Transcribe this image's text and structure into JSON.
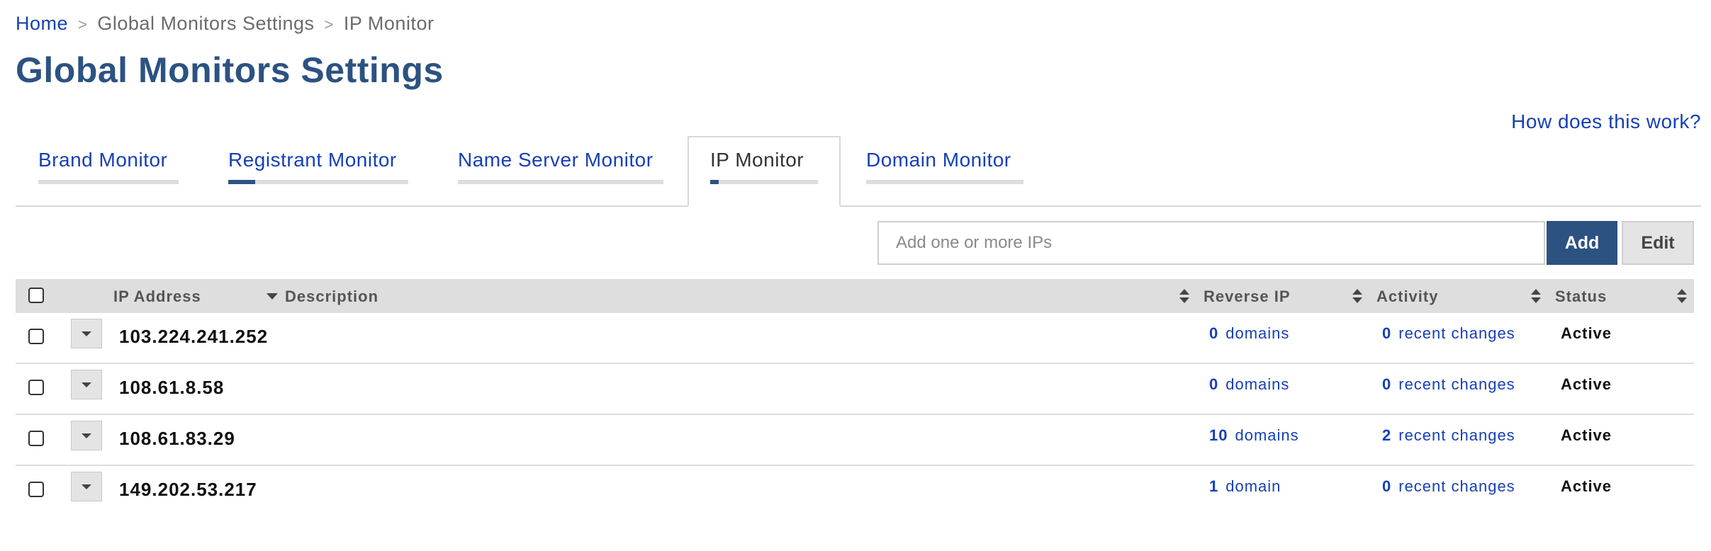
{
  "breadcrumb": {
    "home": "Home",
    "separator": ">",
    "parent": "Global Monitors Settings",
    "current": "IP Monitor"
  },
  "page_title": "Global Monitors Settings",
  "help_link": "How does this work?",
  "tabs": [
    {
      "label": "Brand Monitor",
      "progress": 0,
      "active": false
    },
    {
      "label": "Registrant Monitor",
      "progress": 0.15,
      "active": false
    },
    {
      "label": "Name Server Monitor",
      "progress": 0,
      "active": false
    },
    {
      "label": "IP Monitor",
      "progress": 0.08,
      "active": true
    },
    {
      "label": "Domain Monitor",
      "progress": 0,
      "active": false
    }
  ],
  "ip_input": {
    "placeholder": "Add one or more IPs",
    "value": ""
  },
  "buttons": {
    "add": "Add",
    "edit": "Edit"
  },
  "table": {
    "headers": {
      "ip_address": "IP Address",
      "description": "Description",
      "reverse_ip": "Reverse IP",
      "activity": "Activity",
      "status": "Status"
    },
    "rows": [
      {
        "ip": "103.224.241.252",
        "description": "",
        "reverse_count": "0",
        "reverse_unit": "domains",
        "activity_count": "0",
        "activity_unit": "recent changes",
        "status": "Active"
      },
      {
        "ip": "108.61.8.58",
        "description": "",
        "reverse_count": "0",
        "reverse_unit": "domains",
        "activity_count": "0",
        "activity_unit": "recent changes",
        "status": "Active"
      },
      {
        "ip": "108.61.83.29",
        "description": "",
        "reverse_count": "10",
        "reverse_unit": "domains",
        "activity_count": "2",
        "activity_unit": "recent changes",
        "status": "Active"
      },
      {
        "ip": "149.202.53.217",
        "description": "",
        "reverse_count": "1",
        "reverse_unit": "domain",
        "activity_count": "0",
        "activity_unit": "recent changes",
        "status": "Active"
      }
    ]
  },
  "colors": {
    "link": "#1740b5",
    "primary": "#2c5282",
    "header_bg": "#dedede"
  }
}
